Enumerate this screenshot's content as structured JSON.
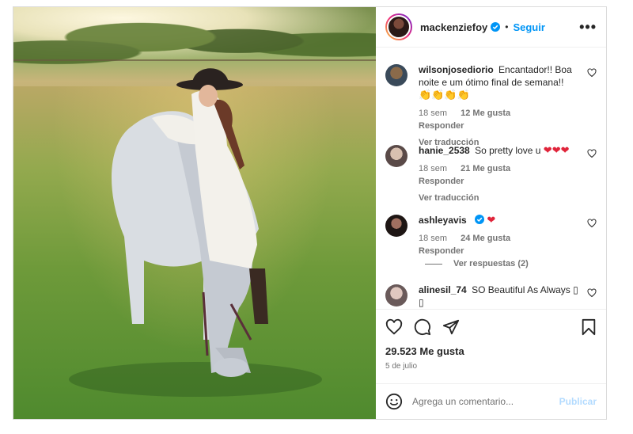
{
  "post": {
    "author": "mackenziefoy",
    "verified": true,
    "separator": "•",
    "follow_label": "Seguir",
    "more_label": "•••",
    "image_alt": "woman in hat leaning on white horse in field"
  },
  "comments": [
    {
      "user": "wilsonjosediorio",
      "text": "Encantador!! Boa noite e um ótimo final de semana!!",
      "emoji": "👏👏👏👏",
      "time": "18 sem",
      "likes": "12 Me gusta",
      "reply": "Responder",
      "translate": "Ver traducción",
      "verified": false
    },
    {
      "user": "hanie_2538",
      "text": "So pretty love u",
      "emoji": "❤❤❤",
      "time": "18 sem",
      "likes": "21 Me gusta",
      "reply": "Responder",
      "translate": "Ver traducción",
      "verified": false
    },
    {
      "user": "ashleyavis",
      "text": "",
      "emoji": "❤",
      "time": "18 sem",
      "likes": "24 Me gusta",
      "reply": "Responder",
      "verified": true
    },
    {
      "user": "alinesil_74",
      "text": "SO Beautiful As Always",
      "emoji": "▯ ▯",
      "verified": false
    }
  ],
  "view_replies": "Ver respuestas (2)",
  "footer": {
    "likes": "29.523 Me gusta",
    "date": "5 de julio",
    "comment_placeholder": "Agrega un comentario...",
    "publish_label": "Publicar"
  },
  "colors": {
    "accent": "#0095f6",
    "heart": "#e0243a",
    "muted": "#737373",
    "border": "#dbdbdb"
  },
  "icons": [
    "verified-icon",
    "more-icon",
    "heart-icon",
    "comment-icon",
    "share-icon",
    "save-icon",
    "emoji-icon"
  ]
}
